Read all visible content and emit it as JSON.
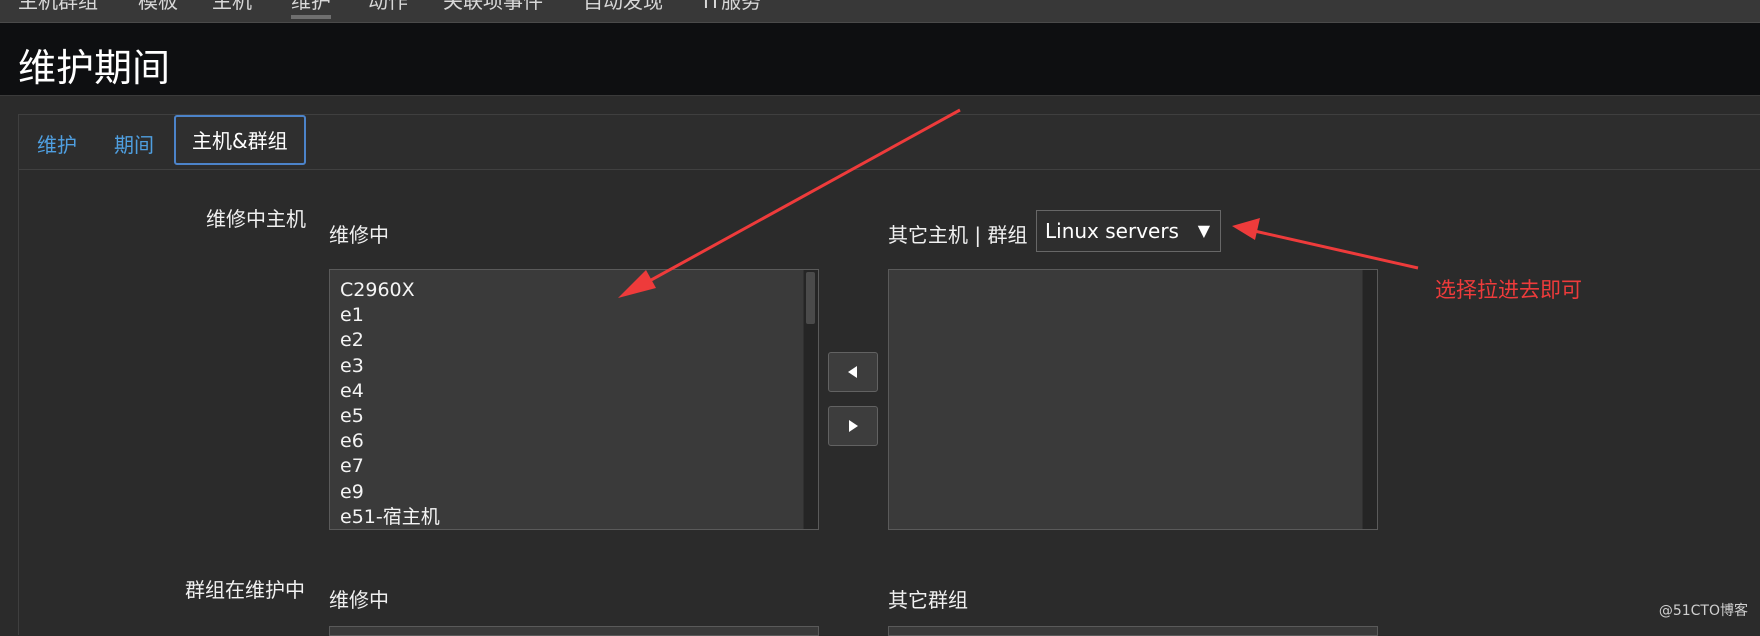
{
  "topnav": {
    "items": [
      "主机群组",
      "模板",
      "主机",
      "维护",
      "动作",
      "关联项事件",
      "自动发现",
      "IT服务"
    ],
    "active": "维护"
  },
  "header": {
    "title": "维护期间"
  },
  "tabs": [
    {
      "label": "维护"
    },
    {
      "label": "期间"
    },
    {
      "label": "主机&群组"
    }
  ],
  "hosts_section": {
    "label": "维修中主机",
    "in_maintenance_label": "维修中",
    "in_maintenance_items": [
      "C2960X",
      "e1",
      "e2",
      "e3",
      "e4",
      "e5",
      "e6",
      "e7",
      "e9",
      "e51-宿主机"
    ],
    "other_label": "其它主机 | 群组",
    "group_select": "Linux servers",
    "other_items": []
  },
  "groups_section": {
    "label": "群组在维护中",
    "in_maintenance_label": "维修中",
    "other_label": "其它群组"
  },
  "annotation": {
    "text": "选择拉进去即可",
    "color": "#ee3b3b"
  },
  "watermark": "@51CTO博客",
  "icons": {
    "move_left": "triangle-left-icon",
    "move_right": "triangle-right-icon",
    "select_chevron": "triangle-down-icon"
  },
  "accent_color": "#4f9fe0"
}
